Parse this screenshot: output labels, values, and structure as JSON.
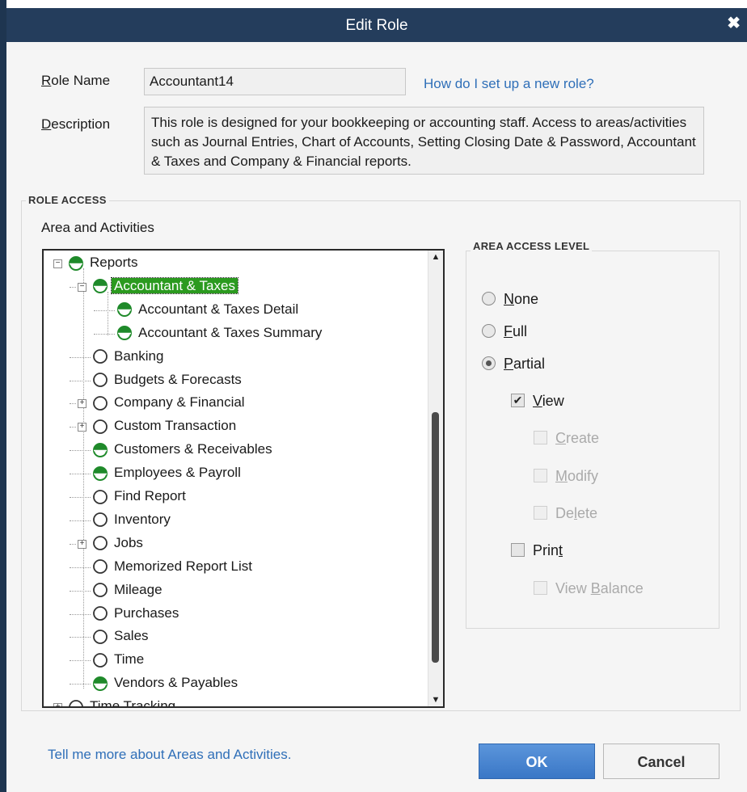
{
  "window": {
    "title": "Edit Role",
    "close_glyph": "✖"
  },
  "form": {
    "role_name_label": "Role Name",
    "role_name_value": "Accountant14",
    "help_link": "How do I set up a new role?",
    "description_label": "Description",
    "description_value": "This role is designed for your bookkeeping or accounting staff. Access to areas/activities such as Journal Entries, Chart of Accounts, Setting Closing Date & Password, Accountant & Taxes and Company & Financial reports."
  },
  "role_access": {
    "group_title": "ROLE ACCESS",
    "tree_label": "Area and Activities",
    "tree": [
      {
        "label": "Reports",
        "level": 0,
        "icon": "half-access-icon",
        "expander": "−"
      },
      {
        "label": "Accountant & Taxes",
        "level": 1,
        "icon": "half-access-icon",
        "expander": "−",
        "selected": true
      },
      {
        "label": "Accountant & Taxes Detail",
        "level": 2,
        "icon": "half-access-icon"
      },
      {
        "label": "Accountant & Taxes Summary",
        "level": 2,
        "icon": "half-access-icon"
      },
      {
        "label": "Banking",
        "level": 1,
        "icon": "no-access-icon"
      },
      {
        "label": "Budgets & Forecasts",
        "level": 1,
        "icon": "no-access-icon"
      },
      {
        "label": "Company & Financial",
        "level": 1,
        "icon": "no-access-icon",
        "expander": "+"
      },
      {
        "label": "Custom Transaction",
        "level": 1,
        "icon": "no-access-icon",
        "expander": "+"
      },
      {
        "label": "Customers & Receivables",
        "level": 1,
        "icon": "half-access-icon"
      },
      {
        "label": "Employees & Payroll",
        "level": 1,
        "icon": "half-access-icon"
      },
      {
        "label": "Find Report",
        "level": 1,
        "icon": "no-access-icon"
      },
      {
        "label": "Inventory",
        "level": 1,
        "icon": "no-access-icon"
      },
      {
        "label": "Jobs",
        "level": 1,
        "icon": "no-access-icon",
        "expander": "+"
      },
      {
        "label": "Memorized Report List",
        "level": 1,
        "icon": "no-access-icon"
      },
      {
        "label": "Mileage",
        "level": 1,
        "icon": "no-access-icon"
      },
      {
        "label": "Purchases",
        "level": 1,
        "icon": "no-access-icon"
      },
      {
        "label": "Sales",
        "level": 1,
        "icon": "no-access-icon"
      },
      {
        "label": "Time",
        "level": 1,
        "icon": "no-access-icon"
      },
      {
        "label": "Vendors & Payables",
        "level": 1,
        "icon": "half-access-icon"
      },
      {
        "label": "Time Tracking",
        "level": 0,
        "icon": "no-access-icon",
        "expander": "+"
      }
    ]
  },
  "access_level": {
    "group_title": "AREA ACCESS LEVEL",
    "options": [
      {
        "label": "None",
        "mnemonic": "N",
        "rest": "one",
        "checked": false
      },
      {
        "label": "Full",
        "mnemonic": "F",
        "rest": "ull",
        "checked": false
      },
      {
        "label": "Partial",
        "mnemonic": "P",
        "rest": "artial",
        "checked": true
      }
    ],
    "checkboxes": [
      {
        "label": "View",
        "pre": "",
        "mnemonic": "V",
        "rest": "iew",
        "checked": true,
        "disabled": false,
        "indent": 1
      },
      {
        "label": "Create",
        "pre": "",
        "mnemonic": "C",
        "rest": "reate",
        "checked": false,
        "disabled": true,
        "indent": 2
      },
      {
        "label": "Modify",
        "pre": "",
        "mnemonic": "M",
        "rest": "odify",
        "checked": false,
        "disabled": true,
        "indent": 2
      },
      {
        "label": "Delete",
        "pre": "De",
        "mnemonic": "l",
        "rest": "ete",
        "checked": false,
        "disabled": true,
        "indent": 2
      },
      {
        "label": "Print",
        "pre": "Prin",
        "mnemonic": "t",
        "rest": "",
        "checked": false,
        "disabled": false,
        "indent": 1
      },
      {
        "label": "View Balance",
        "pre": "View ",
        "mnemonic": "B",
        "rest": "alance",
        "checked": false,
        "disabled": true,
        "indent": 2
      }
    ]
  },
  "footer": {
    "help_link": "Tell me more about Areas and Activities.",
    "ok_label": "OK",
    "cancel_label": "Cancel"
  },
  "colors": {
    "titlebar": "#243d5c",
    "selection": "#2b9a1f",
    "access_icon": "#1f8a2a",
    "link": "#2f6fb8",
    "ok_button": "#3a77c6"
  }
}
